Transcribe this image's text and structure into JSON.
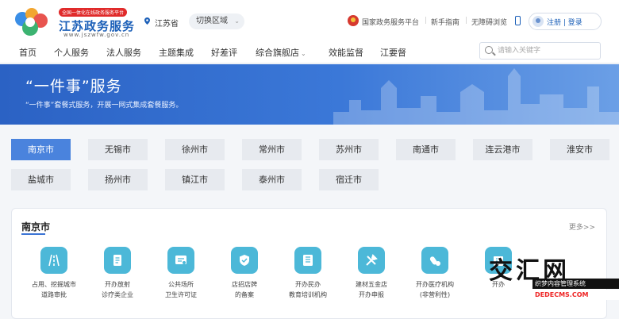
{
  "header": {
    "logo_badge": "全国一体化在线政务服务平台",
    "logo_title": "江苏政务服务",
    "logo_sub": "www.jszwfw.gov.cn",
    "location": "江苏省",
    "switch_region": "切换区域",
    "links": [
      "国家政务服务平台",
      "新手指南",
      "无障碍浏览"
    ],
    "login": "注册 | 登录"
  },
  "nav": {
    "items": [
      "首页",
      "个人服务",
      "法人服务",
      "主题集成",
      "好差评",
      "综合旗舰店",
      "效能监督",
      "江要督"
    ],
    "search_placeholder": "请输入关键字"
  },
  "banner": {
    "title": "“一件事”服务",
    "subtitle": "“一件事”套餐式服务，开展一网式集成套餐服务。"
  },
  "cities": {
    "row1": [
      "南京市",
      "无锡市",
      "徐州市",
      "常州市",
      "苏州市",
      "南通市",
      "连云港市",
      "淮安市"
    ],
    "row2": [
      "盐城市",
      "扬州市",
      "镇江市",
      "泰州市",
      "宿迁市"
    ],
    "selected": "南京市"
  },
  "services": {
    "title": "南京市",
    "more": "更多>>",
    "items": [
      {
        "line1": "占用、挖掘城市",
        "line2": "道路审批",
        "icon": "road-icon"
      },
      {
        "line1": "开办放射",
        "line2": "诊疗类企业",
        "icon": "document-icon"
      },
      {
        "line1": "公共场所",
        "line2": "卫生许可证",
        "icon": "certificate-icon"
      },
      {
        "line1": "店招店牌",
        "line2": "的备案",
        "icon": "shield-icon"
      },
      {
        "line1": "开办民办",
        "line2": "教育培训机构",
        "icon": "book-icon"
      },
      {
        "line1": "建材五金店",
        "line2": "开办申报",
        "icon": "tools-icon"
      },
      {
        "line1": "开办医疗机构",
        "line2": "(非营利性)",
        "icon": "medicine-icon"
      },
      {
        "line1": "开办",
        "line2": "",
        "icon": "building-icon"
      }
    ]
  },
  "watermark": {
    "title": "交汇网",
    "strip": "织梦内容管理系统",
    "url": "DEDECMS.COM"
  }
}
